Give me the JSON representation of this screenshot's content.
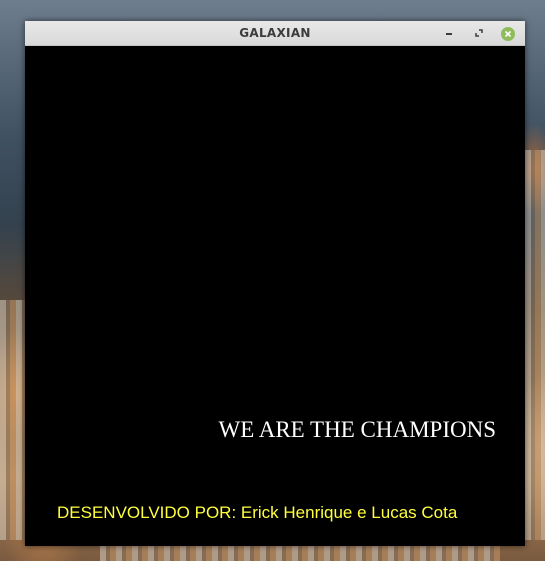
{
  "window": {
    "title": "GALAXIAN",
    "controls": {
      "minimize_icon": "minimize-icon",
      "maximize_icon": "maximize-icon",
      "close_icon": "close-icon"
    }
  },
  "game": {
    "message": "WE ARE THE CHAMPIONS",
    "credits": "DESENVOLVIDO POR: Erick Henrique e Lucas Cota"
  },
  "colors": {
    "background": "#000000",
    "message": "#ffffff",
    "credits": "#ffff3c",
    "close_button": "#8fbc5a",
    "titlebar": "#dcdcdc"
  }
}
